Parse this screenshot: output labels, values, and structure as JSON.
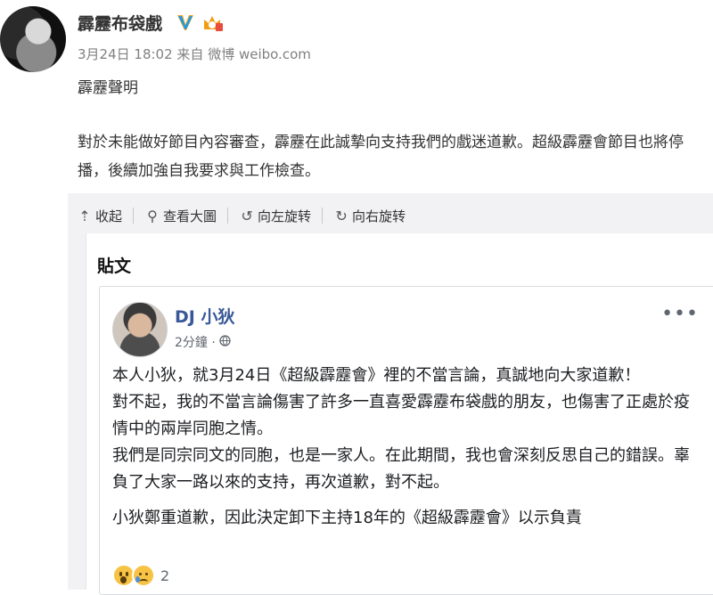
{
  "weibo": {
    "user_name": "霹靂布袋戲",
    "date_time": "3月24日 18:02",
    "source_label": "来自 微博 weibo.com",
    "post_title": "霹靂聲明",
    "post_body": "對於未能做好節目內容審查，霹靂在此誠摯向支持我們的戲迷道歉。超級霹靂會節目也將停播，後續加強自我要求與工作檢查。"
  },
  "toolbar": {
    "items": [
      {
        "icon": "collapse-icon",
        "glyph": "⇡",
        "label": "收起"
      },
      {
        "icon": "magnifier-icon",
        "glyph": "⚲",
        "label": "查看大圖"
      },
      {
        "icon": "rotate-left-icon",
        "glyph": "↺",
        "label": "向左旋转"
      },
      {
        "icon": "rotate-right-icon",
        "glyph": "↻",
        "label": "向右旋转"
      }
    ]
  },
  "card": {
    "title": "貼文"
  },
  "fb_post": {
    "author": "DJ 小狄",
    "time": "2分鐘 ·",
    "paragraphs": [
      "本人小狄，就3月24日《超級霹靂會》裡的不當言論，真誠地向大家道歉！",
      "對不起，我的不當言論傷害了許多一直喜愛霹靂布袋戲的朋友，也傷害了正處於疫情中的兩岸同胞之情。",
      "我們是同宗同文的同胞，也是一家人。在此期間，我也會深刻反思自己的錯誤。辜負了大家一路以來的支持，再次道歉，對不起。",
      "小狄鄭重道歉，因此決定卸下主持18年的《超級霹靂會》以示負責"
    ],
    "reaction_count": "2"
  },
  "colors": {
    "fb_blue": "#385898",
    "weibo_verified": "#1c9ae4",
    "panel_gray": "#f2f2f5"
  }
}
